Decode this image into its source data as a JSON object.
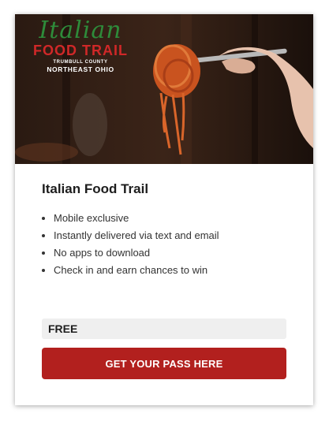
{
  "hero": {
    "logo": {
      "script": "Italian",
      "banner": "FOOD TRAIL",
      "county": "TRUMBULL COUNTY",
      "region": "NORTHEAST OHIO"
    },
    "image_description": "fork-with-spaghetti-photo"
  },
  "pass": {
    "title": "Italian Food Trail",
    "features": [
      "Mobile exclusive",
      "Instantly delivered via text and email",
      "No apps to download",
      "Check in and earn chances to win"
    ],
    "price_label": "FREE",
    "cta_label": "GET YOUR PASS HERE"
  },
  "colors": {
    "cta": "#b2201e",
    "logo_script": "#2e8b3a",
    "logo_banner": "#d02828"
  }
}
